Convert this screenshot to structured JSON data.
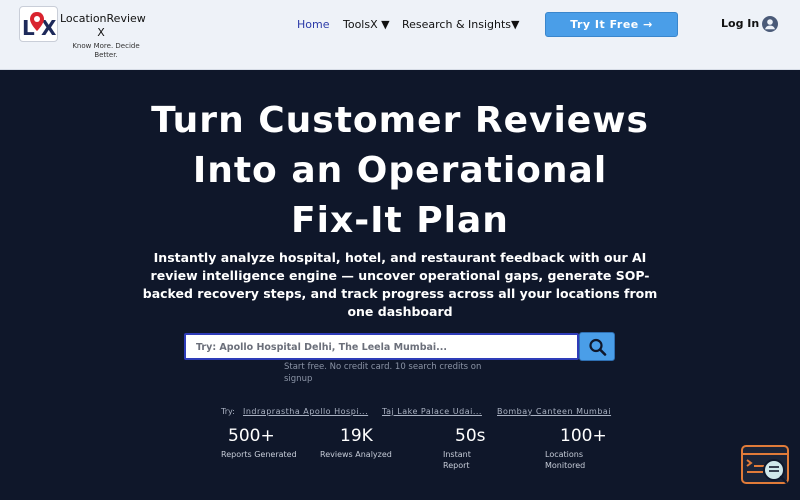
{
  "brand": {
    "name": "LocationReview X",
    "tagline": "Know More. Decide Better."
  },
  "nav": {
    "items": [
      {
        "label": "Home"
      },
      {
        "label": "ToolsX ▼"
      },
      {
        "label": "Research & Insights▼"
      }
    ],
    "cta_label": "Try It Free →",
    "login_label": "Log In"
  },
  "hero": {
    "title": "Turn Customer Reviews Into an Operational Fix-It Plan",
    "subtitle": "Instantly analyze hospital, hotel, and restaurant feedback with our AI review intelligence engine — uncover operational gaps, generate SOP-backed recovery steps, and track progress across all your locations from one dashboard"
  },
  "search": {
    "placeholder": "Try: Apollo Hospital Delhi, The Leela Mumbai...",
    "note": "Start free. No credit card. 10 search credits on signup"
  },
  "suggestions": {
    "label": "Try:",
    "items": [
      "Indraprastha Apollo Hospi...",
      "Taj Lake Palace Udai...",
      "Bombay Canteen Mumbai"
    ]
  },
  "stats": [
    {
      "value": "500+",
      "label": "Reports Generated"
    },
    {
      "value": "19K",
      "label": "Reviews Analyzed"
    },
    {
      "value": "50s",
      "label": "Instant Report"
    },
    {
      "value": "100+",
      "label": "Locations Monitored"
    }
  ],
  "colors": {
    "hero_bg": "#0f172a",
    "header_bg": "#eef2f8",
    "accent": "#4a9ee8",
    "nav_active": "#2b3aa8",
    "search_border": "#2e3cb8",
    "chat_widget": "#e07b39"
  },
  "icons": {
    "search": "magnifier-icon",
    "avatar": "user-circle-icon",
    "chat": "chat-widget-icon",
    "logo": "location-pin-logo"
  }
}
